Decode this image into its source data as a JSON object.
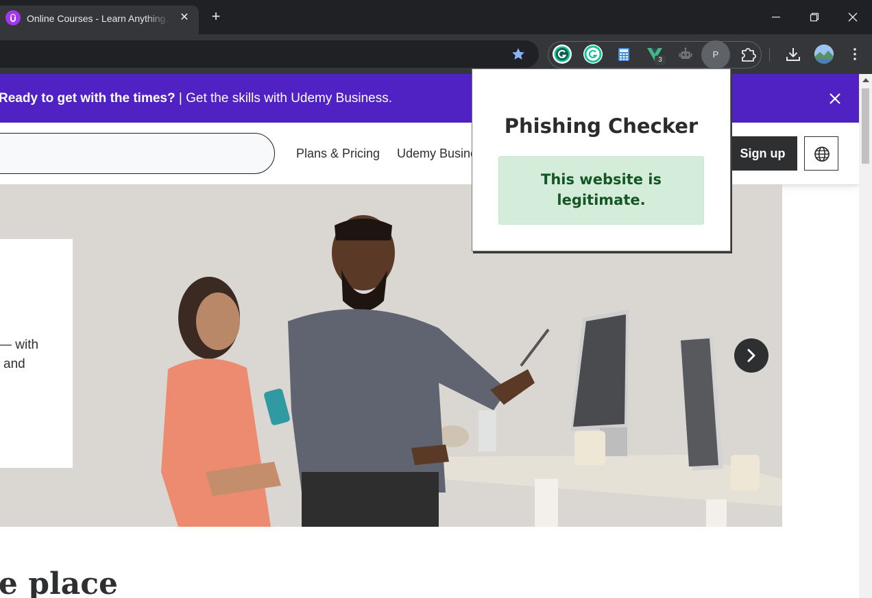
{
  "browser": {
    "tab": {
      "title": "Online Courses - Learn Anything, On Your Schedule | Udemy",
      "favicon": "udemy-favicon-icon"
    },
    "new_tab_label": "+",
    "extensions": [
      "grammarly-icon",
      "grammarly-go-icon",
      "calculator-icon",
      "vue-devtools-icon",
      "robot-icon",
      "phishing-checker-profile-icon",
      "puzzle-icon"
    ],
    "extension_badge": "3",
    "profile_letter": "P"
  },
  "banner": {
    "bold_text": "Ready to get with the times?",
    "separator": " | ",
    "text": "Get the skills with Udemy Business."
  },
  "header": {
    "nav": [
      "Plans & Pricing",
      "Udemy Business"
    ],
    "signup_label": "Sign up"
  },
  "hero": {
    "card_lines": [
      "with",
      "and"
    ]
  },
  "section_heading": "All the skills you need in one place",
  "popup": {
    "title": "Phishing Checker",
    "result": "This website is legitimate.",
    "result_color": "#155724",
    "result_background": "#d4edda"
  },
  "colors": {
    "brand_purple": "#5022c3",
    "dark": "#2d2f31"
  }
}
